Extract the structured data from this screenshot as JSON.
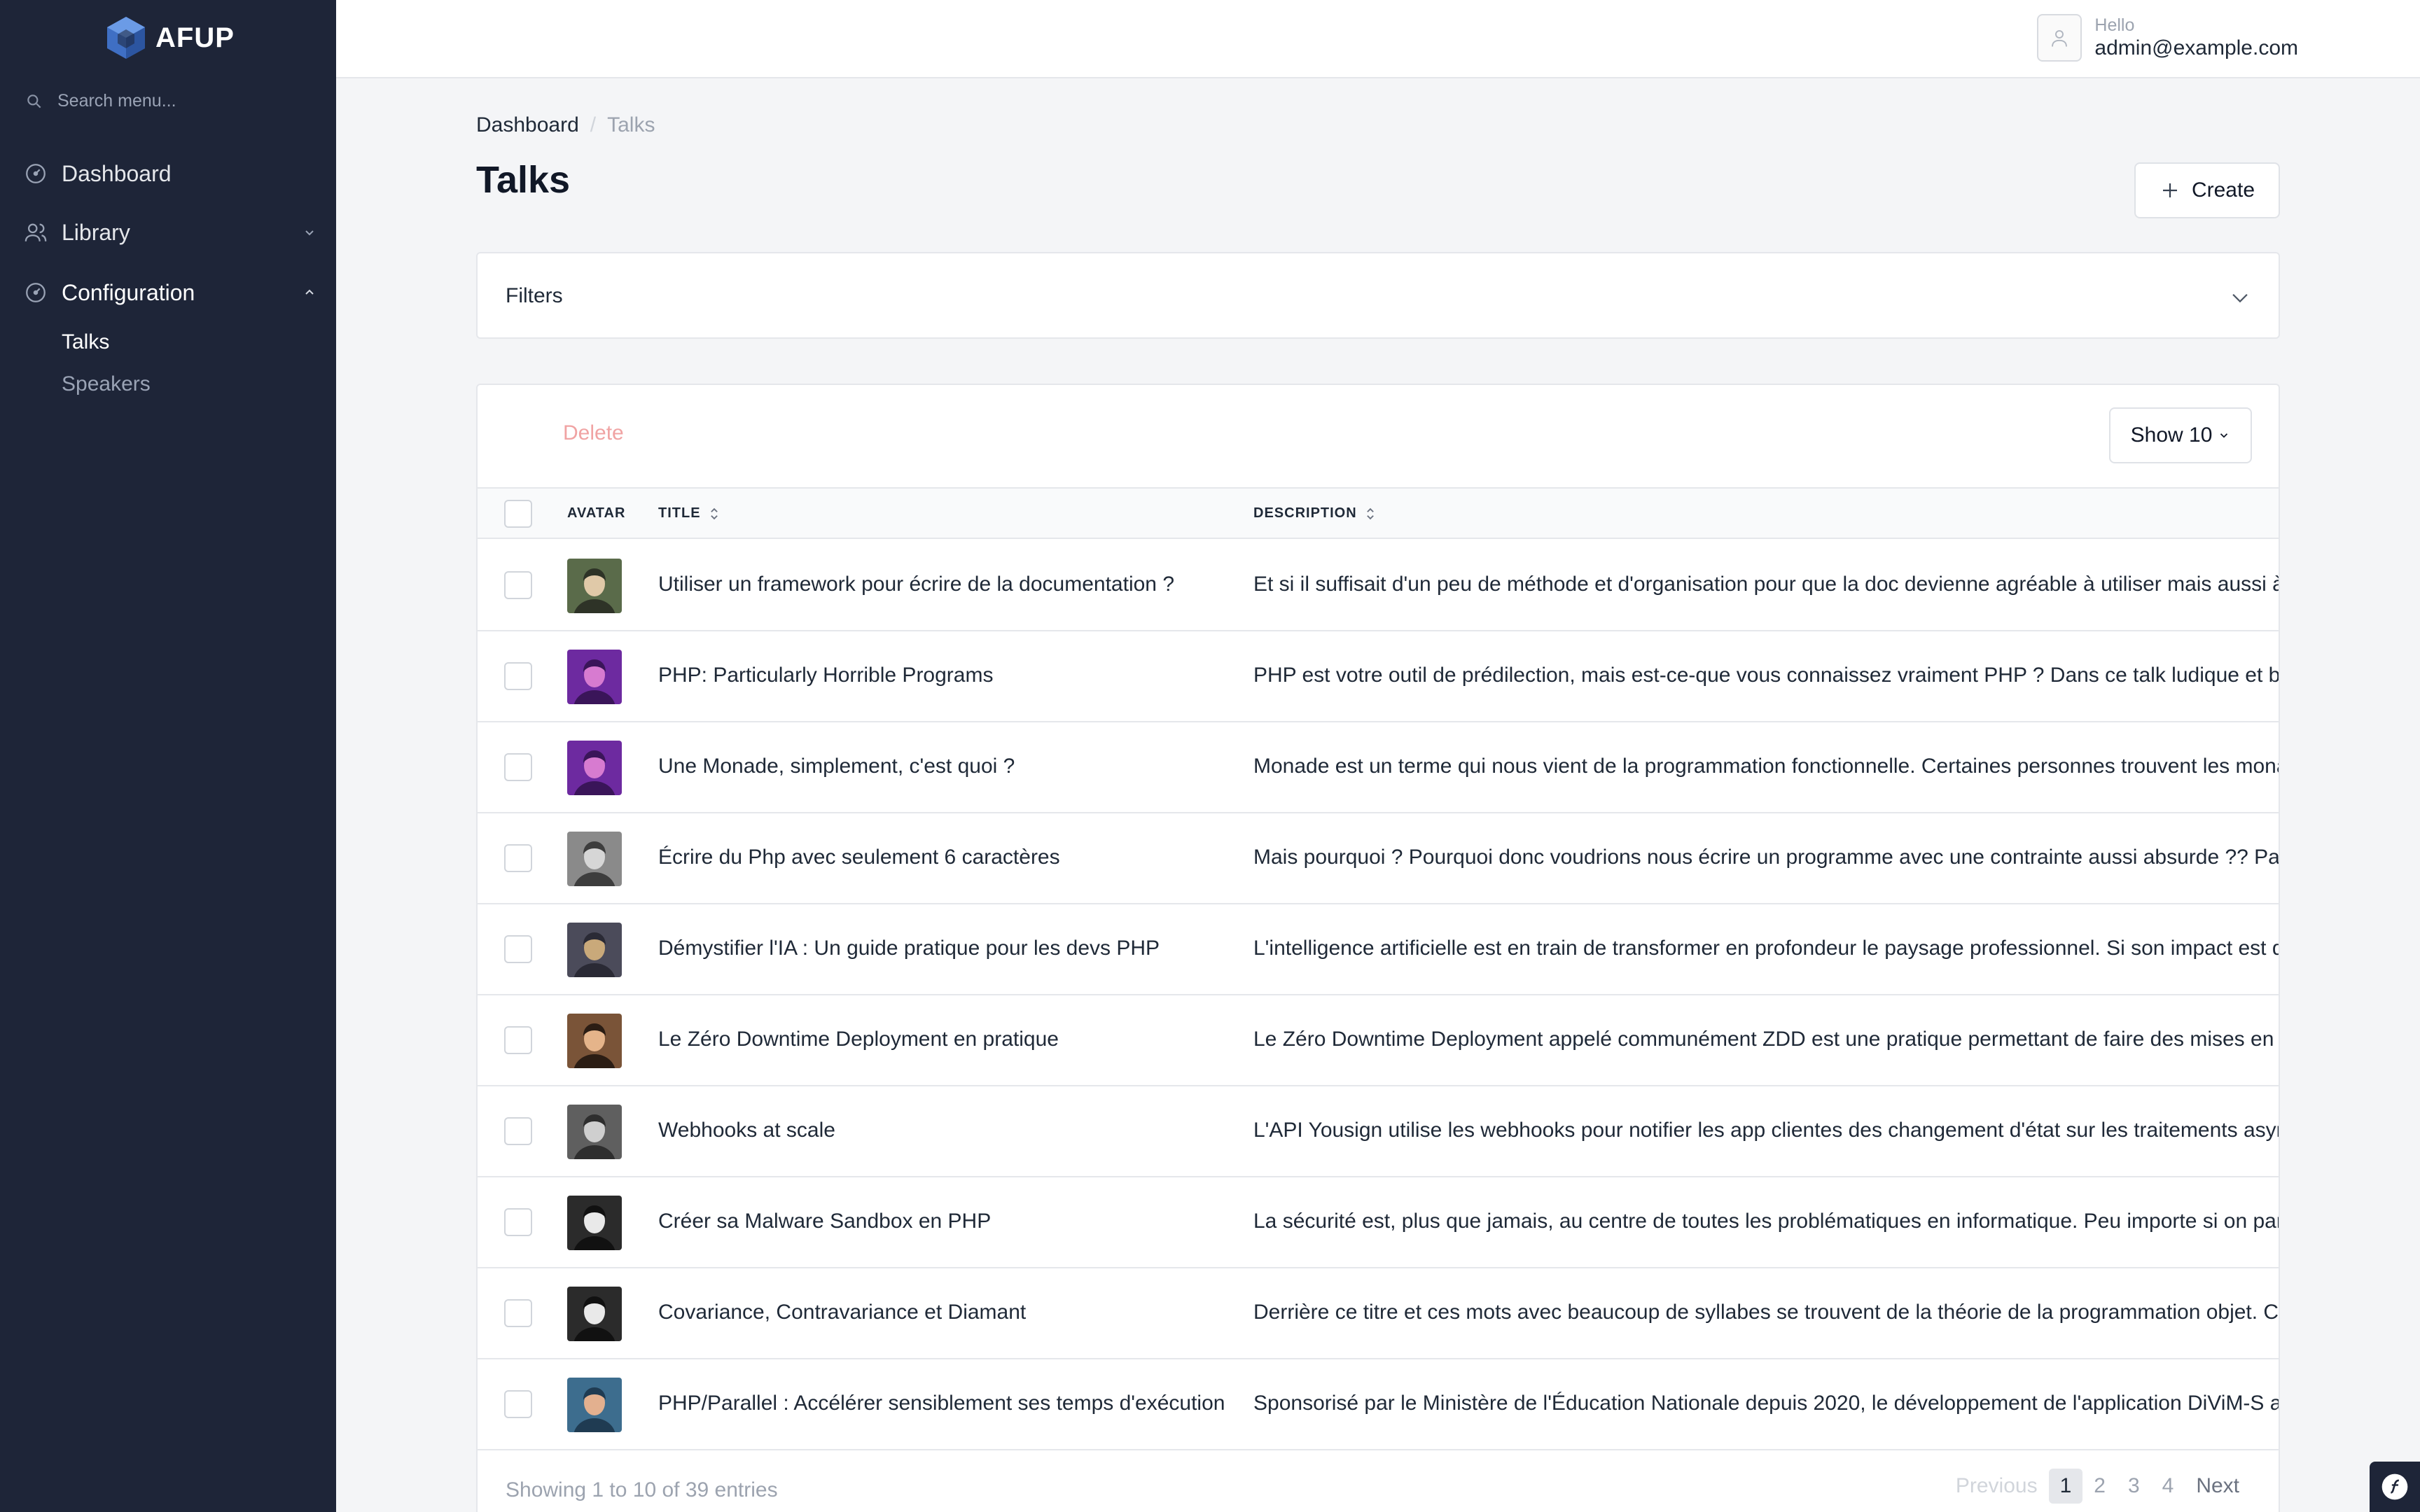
{
  "app": {
    "logo_text": "AFUP"
  },
  "sidebar": {
    "search_placeholder": "Search menu...",
    "items": [
      {
        "label": "Dashboard",
        "icon": "dashboard-icon"
      },
      {
        "label": "Library",
        "icon": "users-icon",
        "expanded": false
      },
      {
        "label": "Configuration",
        "icon": "dashboard-icon",
        "expanded": true
      }
    ],
    "sub_items": [
      {
        "label": "Talks",
        "active": true
      },
      {
        "label": "Speakers",
        "active": false
      }
    ]
  },
  "topbar": {
    "hello": "Hello",
    "email": "admin@example.com"
  },
  "breadcrumb": {
    "root": "Dashboard",
    "separator": "/",
    "current": "Talks"
  },
  "page": {
    "title": "Talks",
    "create_label": "Create"
  },
  "filters": {
    "label": "Filters"
  },
  "toolbar": {
    "delete_label": "Delete",
    "show_label": "Show 10"
  },
  "table": {
    "columns": {
      "avatar": "AVATAR",
      "title": "TITLE",
      "description": "DESCRIPTION"
    },
    "rows": [
      {
        "title": "Utiliser un framework pour écrire de la documentation ?",
        "description": "Et si il suffisait d'un peu de méthode et d'organisation pour que la doc devienne agréable à utiliser mais aussi à écrire",
        "avatar_colors": [
          "#5a6b4a",
          "#e0c9a8",
          "#2e3327"
        ]
      },
      {
        "title": "PHP: Particularly Horrible Programs",
        "description": "PHP est votre outil de prédilection, mais est-ce-que vous connaissez vraiment PHP ? Dans ce talk ludique et bon enfant",
        "avatar_colors": [
          "#6d2aa0",
          "#d77bd0",
          "#3a1559"
        ]
      },
      {
        "title": "Une Monade, simplement, c'est quoi ?",
        "description": "Monade est un terme qui nous vient de la programmation fonctionnelle. Certaines personnes trouvent les monades difficiles",
        "avatar_colors": [
          "#6d2aa0",
          "#d77bd0",
          "#3a1559"
        ]
      },
      {
        "title": "Écrire du Php avec seulement 6 caractères",
        "description": "Mais pourquoi ? Pourquoi donc voudrions nous écrire un programme avec une contrainte aussi absurde ?? Parce que",
        "avatar_colors": [
          "#8a8a8a",
          "#d6d6d6",
          "#3d3d3d"
        ]
      },
      {
        "title": "Démystifier l'IA : Un guide pratique pour les devs PHP",
        "description": "L'intelligence artificielle est en train de transformer en profondeur le paysage professionnel. Si son impact est déjà",
        "avatar_colors": [
          "#4b4b5a",
          "#c9a97a",
          "#2a2a35"
        ]
      },
      {
        "title": "Le Zéro Downtime Deployment en pratique",
        "description": "Le Zéro Downtime Deployment appelé communément ZDD est une pratique permettant de faire des mises en production",
        "avatar_colors": [
          "#7a5438",
          "#e5b48a",
          "#2b1d14"
        ]
      },
      {
        "title": "Webhooks at scale",
        "description": "L'API Yousign utilise les webhooks pour notifier les app clientes des changement d'état sur les traitements asynchrones",
        "avatar_colors": [
          "#5f5f5f",
          "#cfcfcf",
          "#2e2e2e"
        ]
      },
      {
        "title": "Créer sa Malware Sandbox en PHP",
        "description": "La sécurité est, plus que jamais, au centre de toutes les problématiques en informatique. Peu importe si on parle",
        "avatar_colors": [
          "#2b2b2b",
          "#e9e9e9",
          "#111111"
        ]
      },
      {
        "title": "Covariance, Contravariance et Diamant",
        "description": "Derrière ce titre et ces mots avec beaucoup de syllabes se trouvent de la théorie de la programmation objet. Ce talk",
        "avatar_colors": [
          "#2b2b2b",
          "#e9e9e9",
          "#111111"
        ]
      },
      {
        "title": "PHP/Parallel : Accélérer sensiblement ses temps d'exécution",
        "description": "Sponsorisé par le Ministère de l'Éducation Nationale depuis 2020, le développement de l'application DiViM-S a",
        "avatar_colors": [
          "#3d6d8e",
          "#e3b08f",
          "#1f3b52"
        ]
      }
    ]
  },
  "footer": {
    "showing": "Showing 1 to 10 of 39 entries"
  },
  "pagination": {
    "previous": "Previous",
    "pages": [
      "1",
      "2",
      "3",
      "4"
    ],
    "active": "1",
    "next": "Next"
  },
  "colors": {
    "sidebar_bg": "#1e2538",
    "accent": "#4a7bd0",
    "danger_muted": "#f0a3a3"
  }
}
